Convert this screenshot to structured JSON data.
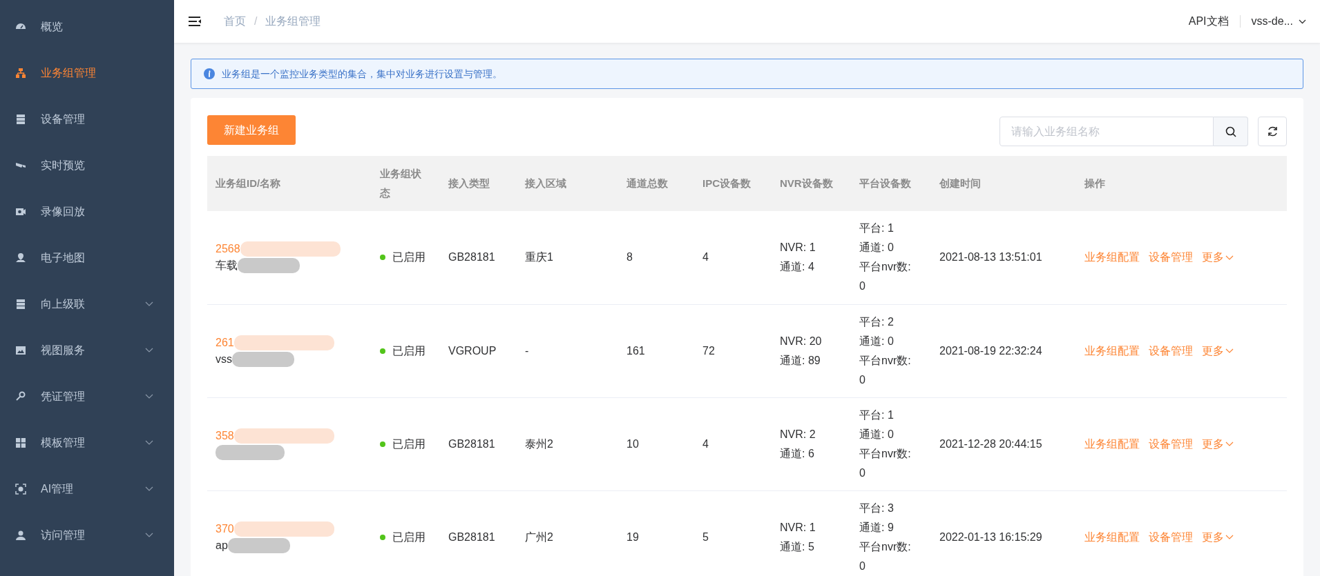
{
  "sidebar": {
    "items": [
      {
        "label": "概览",
        "selected": false,
        "expandable": false
      },
      {
        "label": "业务组管理",
        "selected": true,
        "expandable": false
      },
      {
        "label": "设备管理",
        "selected": false,
        "expandable": false
      },
      {
        "label": "实时预览",
        "selected": false,
        "expandable": false
      },
      {
        "label": "录像回放",
        "selected": false,
        "expandable": false
      },
      {
        "label": "电子地图",
        "selected": false,
        "expandable": false
      },
      {
        "label": "向上级联",
        "selected": false,
        "expandable": true
      },
      {
        "label": "视图服务",
        "selected": false,
        "expandable": true
      },
      {
        "label": "凭证管理",
        "selected": false,
        "expandable": true
      },
      {
        "label": "模板管理",
        "selected": false,
        "expandable": true
      },
      {
        "label": "AI管理",
        "selected": false,
        "expandable": true
      },
      {
        "label": "访问管理",
        "selected": false,
        "expandable": true
      }
    ]
  },
  "header": {
    "breadcrumb": [
      "首页",
      "业务组管理"
    ],
    "separator": "/",
    "api_link": "API文档",
    "user": "vss-de..."
  },
  "alert": {
    "text": "业务组是一个监控业务类型的集合，集中对业务进行设置与管理。"
  },
  "toolbar": {
    "create_button": "新建业务组",
    "search": {
      "placeholder": "请输入业务组名称"
    }
  },
  "table": {
    "columns": [
      "业务组ID/名称",
      "业务组状态",
      "接入类型",
      "接入区域",
      "通道总数",
      "IPC设备数",
      "NVR设备数",
      "平台设备数",
      "创建时间",
      "操作"
    ],
    "rows": [
      {
        "id": "2568",
        "name": "车载",
        "status": "已启用",
        "enabled": true,
        "type": "GB28181",
        "region": "重庆1",
        "channels": "8",
        "ipc": "4",
        "nvr": [
          "NVR: 1",
          "通道: 4"
        ],
        "platform": [
          "平台: 1",
          "通道: 0",
          "平台nvr数:",
          "0"
        ],
        "created": "2021-08-13 13:51:01",
        "actions": [
          "业务组配置",
          "设备管理",
          "更多"
        ]
      },
      {
        "id": "261",
        "name": "vss",
        "status": "已启用",
        "enabled": true,
        "type": "VGROUP",
        "region": "-",
        "channels": "161",
        "ipc": "72",
        "nvr": [
          "NVR: 20",
          "通道: 89"
        ],
        "platform": [
          "平台: 2",
          "通道: 0",
          "平台nvr数:",
          "0"
        ],
        "created": "2021-08-19 22:32:24",
        "actions": [
          "业务组配置",
          "设备管理",
          "更多"
        ]
      },
      {
        "id": "358",
        "status": "已启用",
        "enabled": true,
        "type": "GB28181",
        "region": "泰州2",
        "channels": "10",
        "ipc": "4",
        "nvr": [
          "NVR: 2",
          "通道: 6"
        ],
        "platform": [
          "平台: 1",
          "通道: 0",
          "平台nvr数:",
          "0"
        ],
        "created": "2021-12-28 20:44:15",
        "actions": [
          "业务组配置",
          "设备管理",
          "更多"
        ]
      },
      {
        "id": "370",
        "name": "ap",
        "status": "已启用",
        "enabled": true,
        "type": "GB28181",
        "region": "广州2",
        "channels": "19",
        "ipc": "5",
        "nvr": [
          "NVR: 1",
          "通道: 5"
        ],
        "platform": [
          "平台: 3",
          "通道: 9",
          "平台nvr数:",
          "0"
        ],
        "created": "2022-01-13 16:15:29",
        "actions": [
          "业务组配置",
          "设备管理",
          "更多"
        ]
      }
    ]
  }
}
